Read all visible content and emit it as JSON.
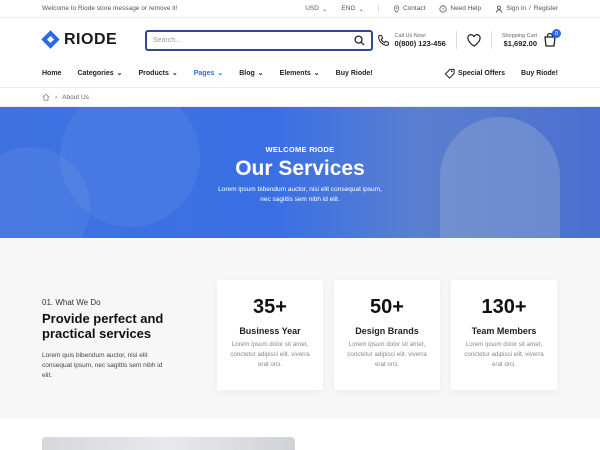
{
  "topbar": {
    "message": "Welcome to Riode store message or remove it!",
    "currency": "USD",
    "language": "ENG",
    "contact": "Contact",
    "help": "Need Help",
    "signin": "Sign in",
    "divider": "/",
    "register": "Register"
  },
  "header": {
    "logo": "RIODE",
    "search_placeholder": "Search...",
    "call_label": "Call Us Now:",
    "call_number": "0(800) 123-456",
    "cart_label": "Shopping Cart",
    "cart_total": "$1,692.00",
    "cart_count": "0"
  },
  "nav": {
    "items": [
      {
        "label": "Home"
      },
      {
        "label": "Categories"
      },
      {
        "label": "Products"
      },
      {
        "label": "Pages"
      },
      {
        "label": "Blog"
      },
      {
        "label": "Elements"
      },
      {
        "label": "Buy Riode!"
      }
    ],
    "special_offers": "Special Offers",
    "buy_right": "Buy Riode!"
  },
  "breadcrumb": {
    "current": "About Us"
  },
  "hero": {
    "eyebrow": "WELCOME RIODE",
    "title": "Our Services",
    "line1": "Lorem ipsum bibendum auctor, nisi elit consequat ipsum,",
    "line2": "nec sagittis sem nibh id elit."
  },
  "what": {
    "eyebrow": "01. What We Do",
    "title": "Provide perfect and practical services",
    "desc": "Lorem quis bibendum auctor, nisi elit consequat ipsum, nec sagittis sem nibh id elit."
  },
  "cards": [
    {
      "num": "35+",
      "label": "Business Year",
      "text": "Lorem ipsum dolor sit amet, conctetur adipisci elit. viverra erat orci."
    },
    {
      "num": "50+",
      "label": "Design Brands",
      "text": "Lorem ipsum dolor sit amet, conctetur adipisci elit. viverra erat orci."
    },
    {
      "num": "130+",
      "label": "Team Members",
      "text": "Lorem ipsum dolor sit amet, conctetur adipisci elit. viverra erat orci."
    }
  ],
  "colors": {
    "accent": "#2a6be4",
    "hero": "#3f72e0"
  }
}
